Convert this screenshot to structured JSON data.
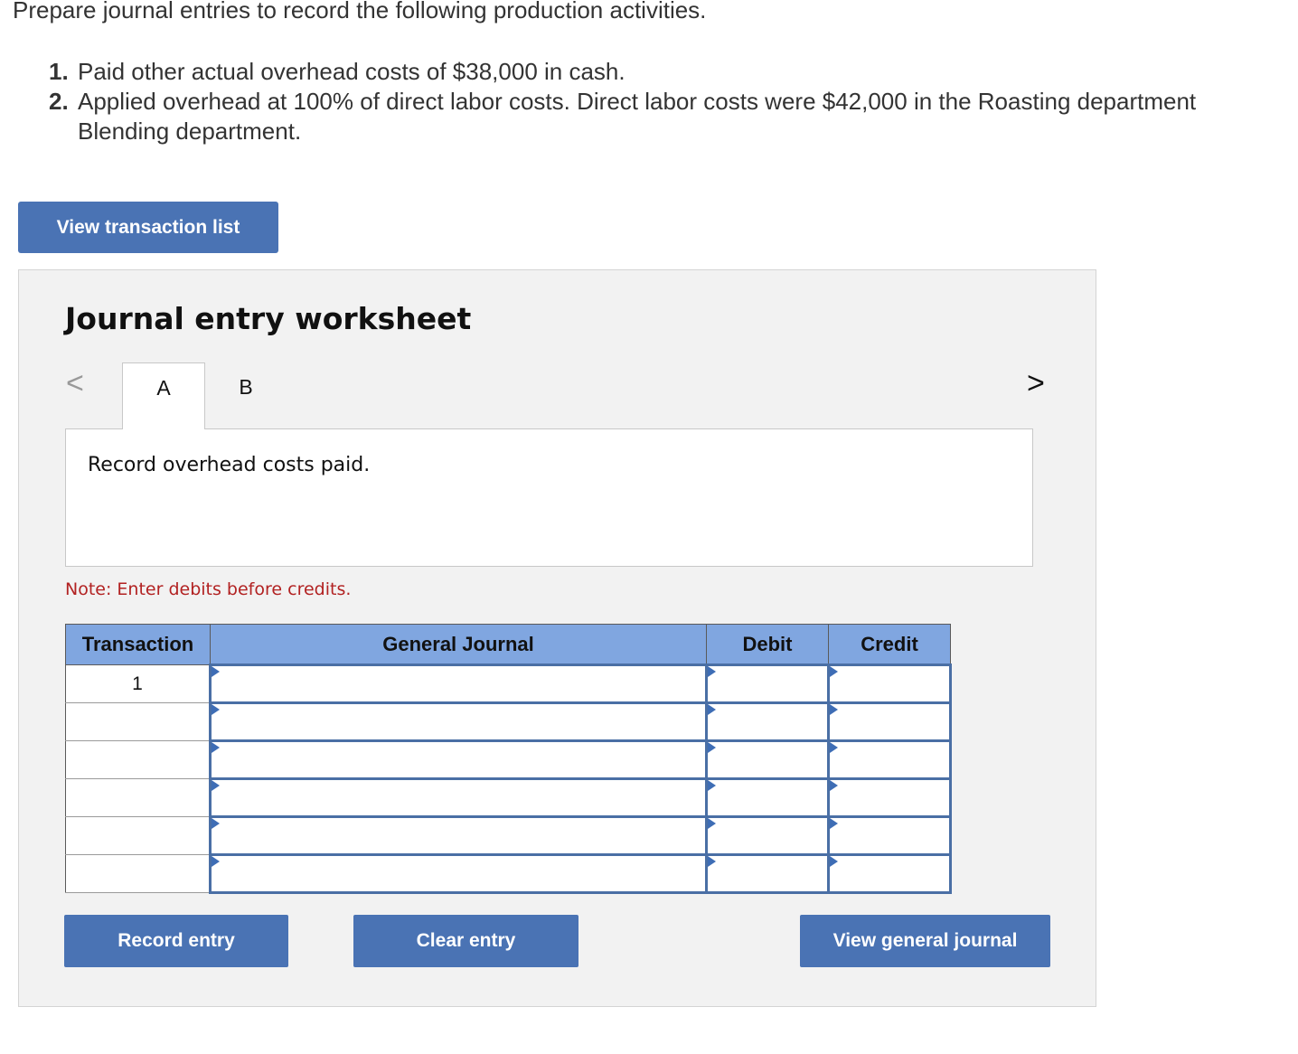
{
  "intro_text": "Prepare journal entries to record the following production activities.",
  "steps": [
    {
      "num": "1.",
      "text": "Paid other actual overhead costs of $38,000 in cash."
    },
    {
      "num": "2.",
      "text": "Applied overhead at 100% of direct labor costs. Direct labor costs were $42,000 in the Roasting department",
      "text_line2": "Blending department."
    }
  ],
  "view_transaction_list_label": "View transaction list",
  "worksheet": {
    "title": "Journal entry worksheet",
    "nav_prev": "<",
    "nav_next": ">",
    "tabs": [
      {
        "label": "A",
        "active": true
      },
      {
        "label": "B",
        "active": false
      }
    ],
    "description": "Record overhead costs paid.",
    "note": "Note: Enter debits before credits."
  },
  "table": {
    "headers": {
      "transaction": "Transaction",
      "general_journal": "General Journal",
      "debit": "Debit",
      "credit": "Credit"
    },
    "rows": [
      {
        "transaction": "1",
        "account": "",
        "debit": "",
        "credit": ""
      },
      {
        "transaction": "",
        "account": "",
        "debit": "",
        "credit": ""
      },
      {
        "transaction": "",
        "account": "",
        "debit": "",
        "credit": ""
      },
      {
        "transaction": "",
        "account": "",
        "debit": "",
        "credit": ""
      },
      {
        "transaction": "",
        "account": "",
        "debit": "",
        "credit": ""
      },
      {
        "transaction": "",
        "account": "",
        "debit": "",
        "credit": ""
      }
    ]
  },
  "buttons": {
    "record": "Record entry",
    "clear": "Clear entry",
    "view_journal": "View general journal"
  },
  "colors": {
    "button_blue": "#4a73b4",
    "header_blue": "#80a6e0",
    "note_red": "#b22222",
    "panel_gray": "#f2f2f2"
  }
}
